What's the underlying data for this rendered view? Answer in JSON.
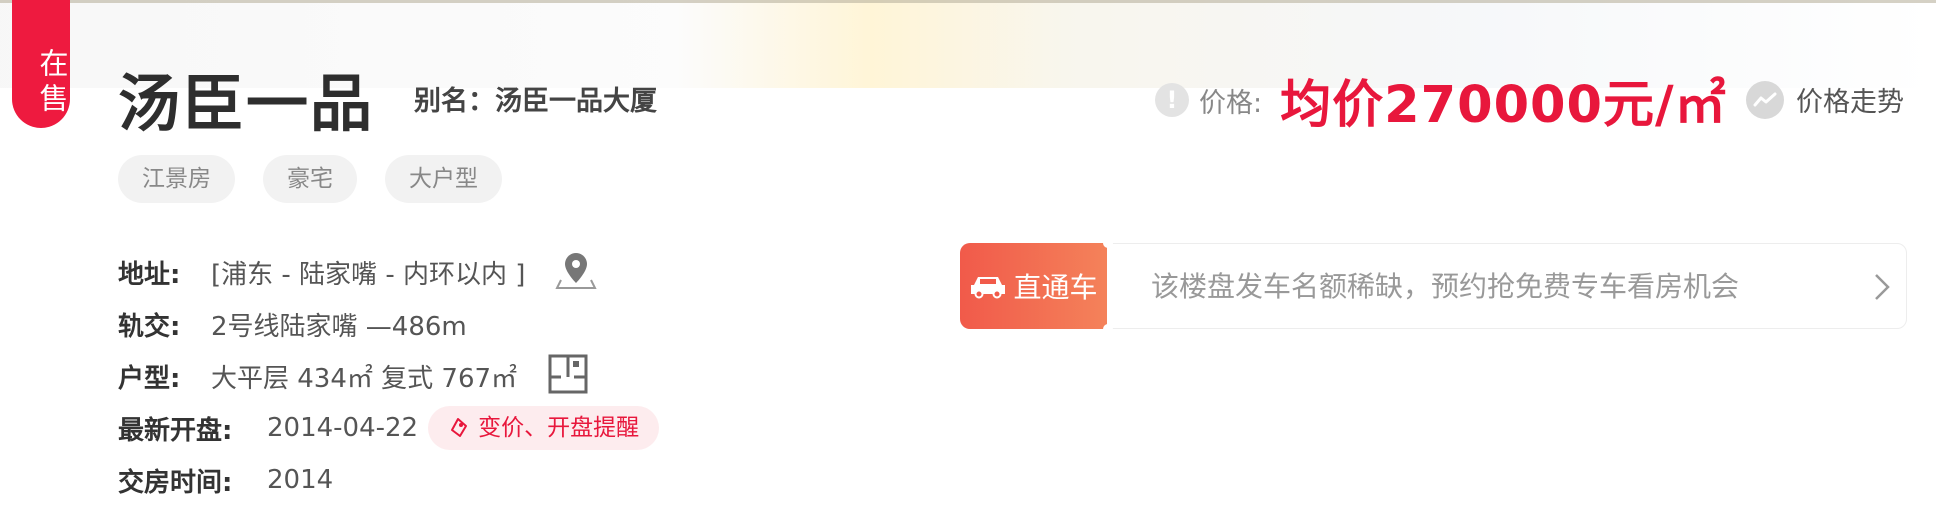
{
  "status_ribbon": "在售",
  "title": "汤臣一品",
  "alias": "别名：汤臣一品大厦",
  "tags": [
    "江景房",
    "豪宅",
    "大户型"
  ],
  "price": {
    "label": "价格:",
    "value": "均价270000元/㎡",
    "trend_label": "价格走势"
  },
  "info": {
    "address_key": "地址:",
    "address_val": "[浦东 - 陆家嘴 - 内环以内 ]",
    "transit_key": "轨交:",
    "transit_val": "2号线陆家嘴 —486m",
    "layout_key": "户型:",
    "layout_val": "大平层 434㎡ 复式 767㎡",
    "opening_key": "最新开盘:",
    "opening_val": "2014-04-22",
    "remind_label": "变价、开盘提醒",
    "delivery_key": "交房时间:",
    "delivery_val": "2014"
  },
  "car": {
    "badge": "直通车",
    "text": "该楼盘发车名额稀缺，预约抢免费专车看房机会"
  },
  "colors": {
    "accent": "#e8173c",
    "ribbon": "#ee1a3f",
    "car_badge": "#f15a4a"
  },
  "icons": [
    "warning-icon",
    "trend-icon",
    "map-pin-icon",
    "floor-plan-icon",
    "bell-icon",
    "car-icon",
    "chevron-right-icon"
  ]
}
